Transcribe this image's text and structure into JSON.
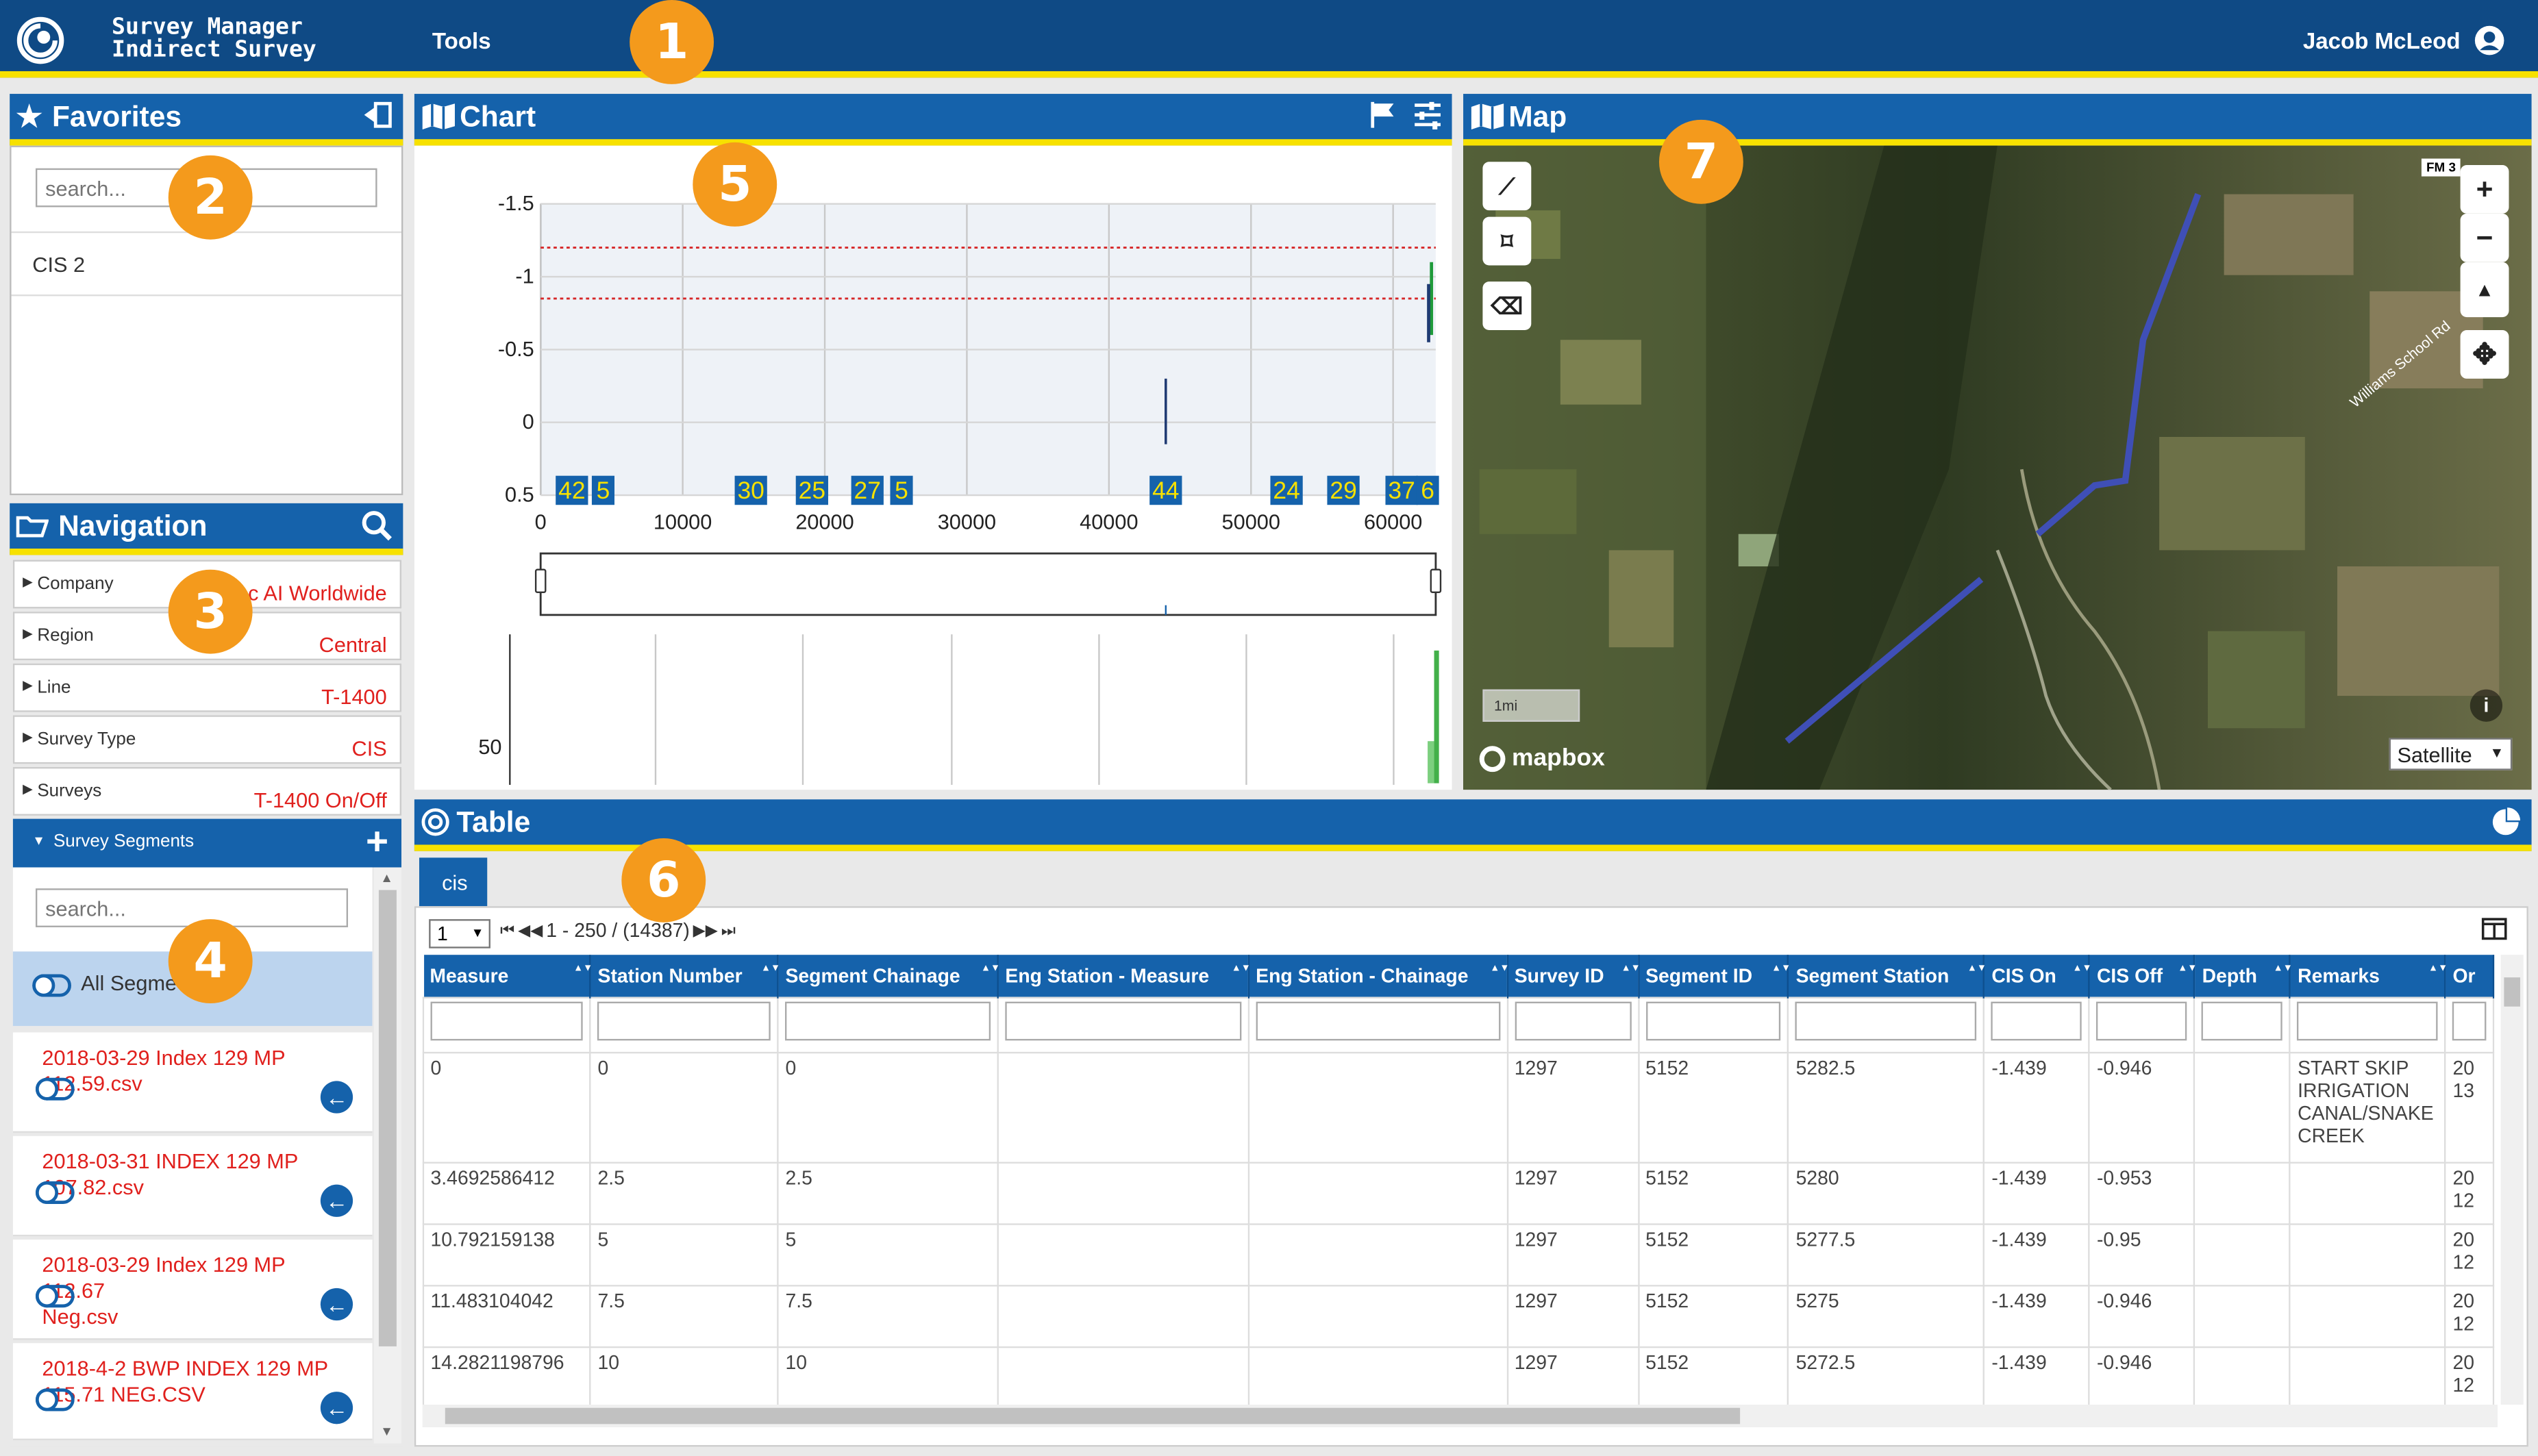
{
  "header": {
    "app_title_line1": "Survey Manager",
    "app_title_line2": "Indirect Survey",
    "tools_label": "Tools",
    "user_name": "Jacob McLeod"
  },
  "callouts": [
    "1",
    "2",
    "3",
    "4",
    "5",
    "6",
    "7"
  ],
  "favorites": {
    "title": "Favorites",
    "search_placeholder": "search...",
    "items": [
      "CIS 2"
    ]
  },
  "navigation": {
    "title": "Navigation",
    "rows": [
      {
        "label": "Company",
        "value": "oc AI Worldwide"
      },
      {
        "label": "Region",
        "value": "Central"
      },
      {
        "label": "Line",
        "value": "T-1400"
      },
      {
        "label": "Survey Type",
        "value": "CIS"
      },
      {
        "label": "Surveys",
        "value": "T-1400 On/Off"
      }
    ],
    "segments_label": "Survey Segments",
    "segments_search_placeholder": "search...",
    "all_segments_label": "All Segme",
    "segments": [
      {
        "line1": "2018-03-29 Index 129 MP",
        "line2": "112.59.csv"
      },
      {
        "line1": "2018-03-31 INDEX 129 MP",
        "line2": "107.82.csv"
      },
      {
        "line1": "2018-03-29 Index 129 MP 112.67",
        "line2": "Neg.csv"
      },
      {
        "line1": "2018-4-2 BWP INDEX 129 MP",
        "line2": "115.71 NEG.CSV"
      }
    ]
  },
  "chart": {
    "title": "Chart",
    "chart_data": {
      "type": "line",
      "title": "",
      "xlabel": "",
      "ylabel": "",
      "ylim": [
        0.5,
        -1.5
      ],
      "xlim": [
        0,
        63000
      ],
      "y_ticks": [
        "-1.5",
        "-1",
        "-0.5",
        "0",
        "0.5"
      ],
      "x_ticks": [
        "0",
        "10000",
        "20000",
        "30000",
        "40000",
        "50000",
        "60000"
      ],
      "threshold_lines": [
        -1.2,
        -0.85
      ],
      "markers": [
        {
          "label": "42",
          "x": 2200
        },
        {
          "label": "5",
          "x": 4400
        },
        {
          "label": "30",
          "x": 14800
        },
        {
          "label": "25",
          "x": 19100
        },
        {
          "label": "27",
          "x": 23000
        },
        {
          "label": "5",
          "x": 25400
        },
        {
          "label": "44",
          "x": 44000
        },
        {
          "label": "24",
          "x": 52500
        },
        {
          "label": "29",
          "x": 56500
        },
        {
          "label": "37",
          "x": 60600
        },
        {
          "label": "6",
          "x": 63000
        }
      ],
      "lower_y_tick": "50"
    }
  },
  "map": {
    "title": "Map",
    "scale_label": "1mi",
    "attribution": "mapbox",
    "layer_select": "Satellite",
    "road_label_1": "Williams School Rd",
    "road_label_2": "FM 3"
  },
  "table": {
    "title": "Table",
    "tab_label": "cis",
    "page_select": "1",
    "pager_text": "1 - 250 / (14387)",
    "columns": [
      "Measure",
      "Station Number",
      "Segment Chainage",
      "Eng Station - Measure",
      "Eng Station - Chainage",
      "Survey ID",
      "Segment ID",
      "Segment Station",
      "CIS On",
      "CIS Off",
      "Depth",
      "Remarks",
      "Or"
    ],
    "rows": [
      [
        "0",
        "0",
        "0",
        "",
        "",
        "1297",
        "5152",
        "5282.5",
        "-1.439",
        "-0.946",
        "",
        "START SKIP IRRIGATION CANAL/SNAKE CREEK",
        "20 13"
      ],
      [
        "3.4692586412",
        "2.5",
        "2.5",
        "",
        "",
        "1297",
        "5152",
        "5280",
        "-1.439",
        "-0.953",
        "",
        "",
        "20 12"
      ],
      [
        "10.792159138",
        "5",
        "5",
        "",
        "",
        "1297",
        "5152",
        "5277.5",
        "-1.439",
        "-0.95",
        "",
        "",
        "20 12"
      ],
      [
        "11.483104042",
        "7.5",
        "7.5",
        "",
        "",
        "1297",
        "5152",
        "5275",
        "-1.439",
        "-0.946",
        "",
        "",
        "20 12"
      ],
      [
        "14.2821198796",
        "10",
        "10",
        "",
        "",
        "1297",
        "5152",
        "5272.5",
        "-1.439",
        "-0.946",
        "",
        "",
        "20 12"
      ]
    ]
  }
}
